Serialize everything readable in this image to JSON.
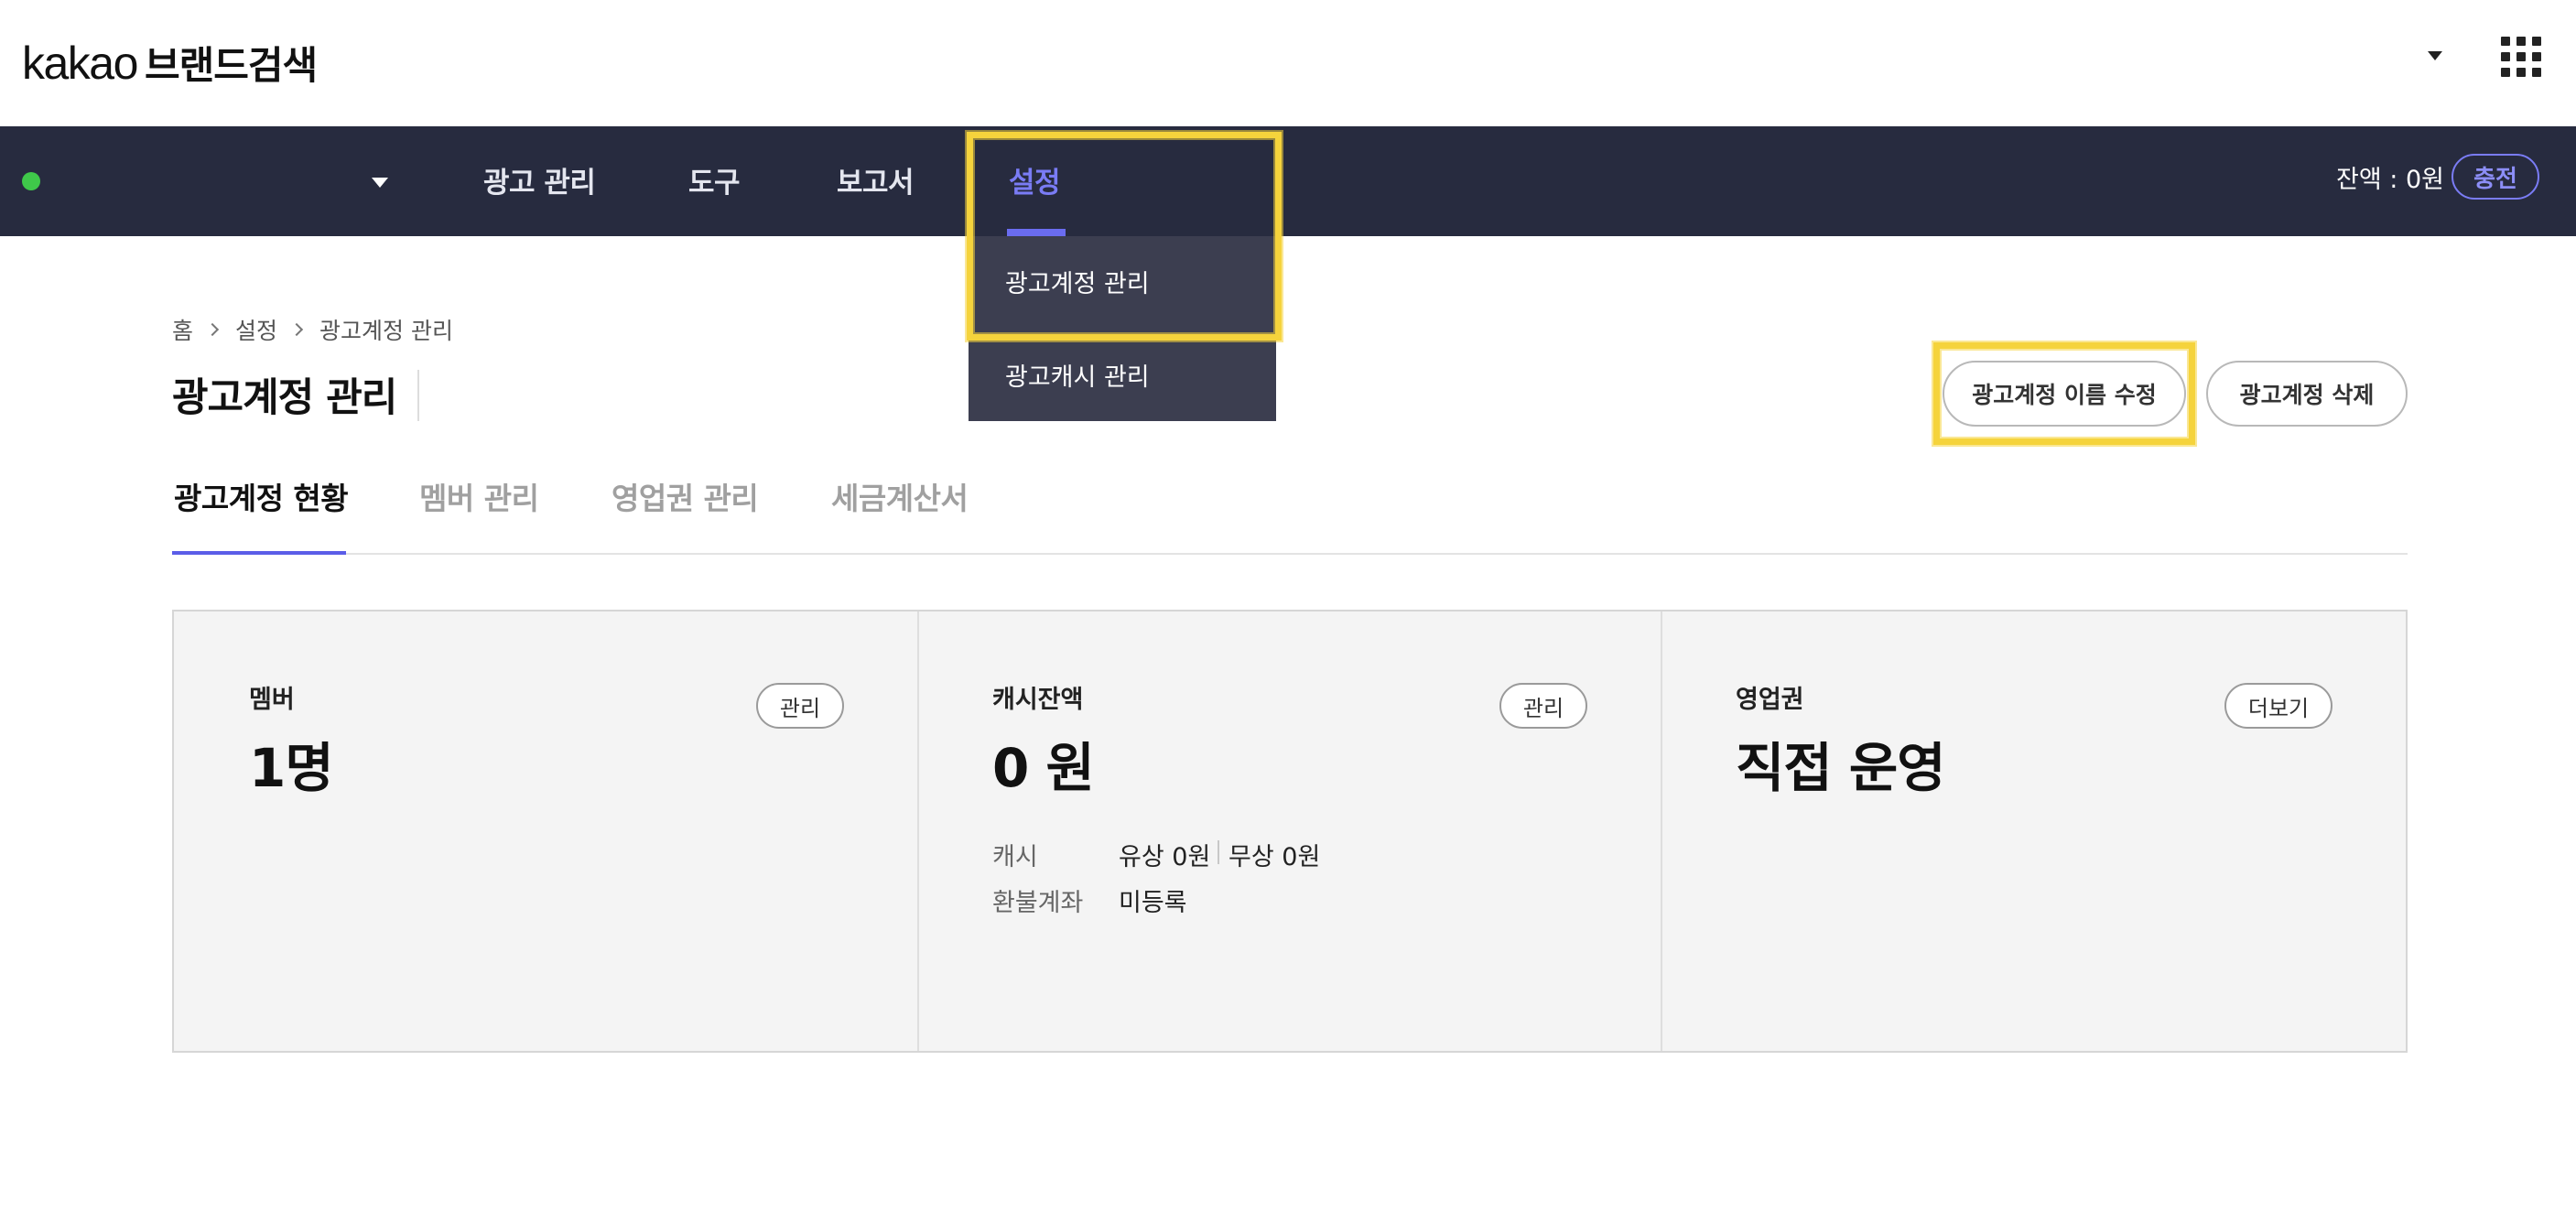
{
  "header": {
    "logo_brand": "kakao",
    "logo_service": "브랜드검색",
    "icons": {
      "dropdown": "caret-down-icon",
      "apps": "apps-grid-icon"
    }
  },
  "nav": {
    "status_color": "#3fc84a",
    "items": [
      {
        "label": "광고 관리"
      },
      {
        "label": "도구"
      },
      {
        "label": "보고서"
      },
      {
        "label": "설정"
      }
    ],
    "active_item": "설정",
    "balance": "잔액 : 0원",
    "charge_label": "충전"
  },
  "dropdown": {
    "items": [
      {
        "label": "광고계정 관리"
      },
      {
        "label": "광고캐시 관리"
      }
    ]
  },
  "breadcrumb": [
    "홈",
    "설정",
    "광고계정 관리"
  ],
  "page": {
    "title": "광고계정 관리",
    "rename_button": "광고계정 이름 수정",
    "delete_button": "광고계정 삭제"
  },
  "tabs": [
    {
      "label": "광고계정 현황"
    },
    {
      "label": "멤버 관리"
    },
    {
      "label": "영업권 관리"
    },
    {
      "label": "세금계산서"
    }
  ],
  "active_tab": "광고계정 현황",
  "cards": {
    "member": {
      "label": "멤버",
      "value": "1명",
      "button": "관리"
    },
    "cash": {
      "label": "캐시잔액",
      "value": "0 원",
      "button": "관리",
      "cash_label": "캐시",
      "paid": "유상 0원",
      "free": "무상 0원",
      "refund_label": "환불계좌",
      "refund_value": "미등록"
    },
    "business": {
      "label": "영업권",
      "value": "직접 운영",
      "button": "더보기"
    }
  },
  "colors": {
    "nav_bg": "#272b3f",
    "accent": "#6a6cf0",
    "highlight": "#f5d33c"
  }
}
